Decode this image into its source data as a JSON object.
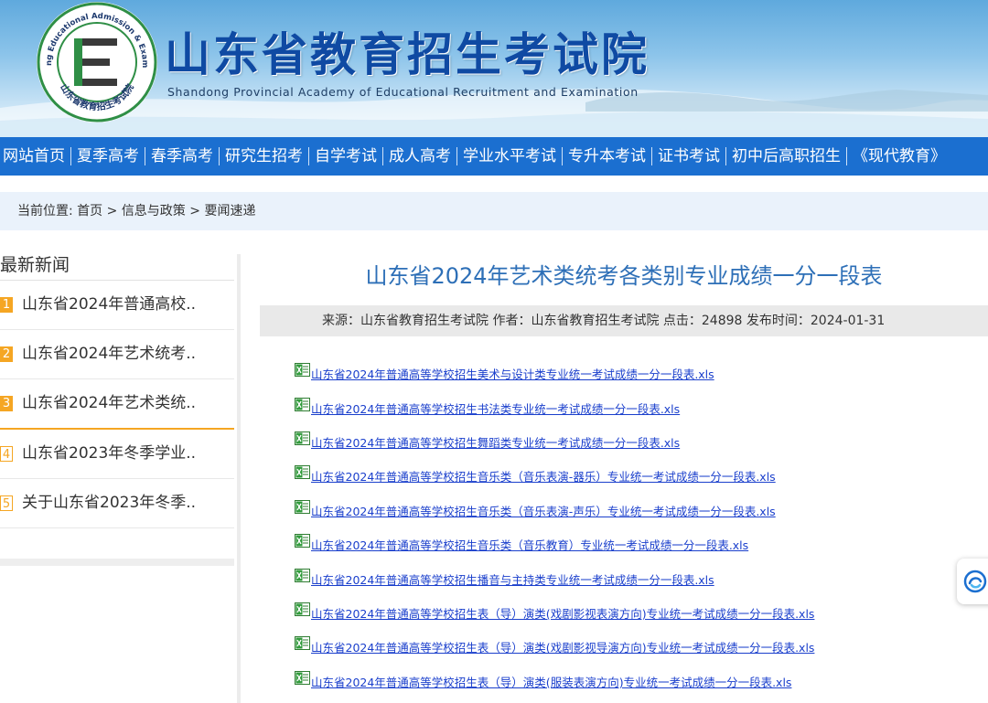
{
  "header": {
    "title": "山东省教育招生考试院",
    "subtitle": "Shandong Provincial Academy of Educational Recruitment and Examination",
    "logo": {
      "ring_text_top": "Shandong Educational Admission & Examination",
      "ring_text_bottom": "山东省教育招生考试院",
      "center_letter": "E"
    }
  },
  "nav": {
    "items": [
      "网站首页",
      "夏季高考",
      "春季高考",
      "研究生招考",
      "自学考试",
      "成人高考",
      "学业水平考试",
      "专升本考试",
      "证书考试",
      "初中后高职招生",
      "《现代教育》"
    ]
  },
  "breadcrumb": {
    "prefix": "当前位置:",
    "items": [
      "首页",
      "信息与政策",
      "要闻速递"
    ],
    "separator": ">"
  },
  "sidebar": {
    "title": "最新新闻",
    "items": [
      {
        "num": "1",
        "text": "山东省2024年普通高校.."
      },
      {
        "num": "2",
        "text": "山东省2024年艺术统考.."
      },
      {
        "num": "3",
        "text": "山东省2024年艺术类统.."
      },
      {
        "num": "4",
        "text": "山东省2023年冬季学业.."
      },
      {
        "num": "5",
        "text": "关于山东省2023年冬季.."
      }
    ]
  },
  "article": {
    "title": "山东省2024年艺术类统考各类别专业成绩一分一段表",
    "meta": "来源：山东省教育招生考试院 作者：山东省教育招生考试院 点击：24898 发布时间：2024-01-31",
    "files": [
      "山东省2024年普通高等学校招生美术与设计类专业统一考试成绩一分一段表.xls",
      "山东省2024年普通高等学校招生书法类专业统一考试成绩一分一段表.xls",
      "山东省2024年普通高等学校招生舞蹈类专业统一考试成绩一分一段表.xls",
      "山东省2024年普通高等学校招生音乐类（音乐表演-器乐）专业统一考试成绩一分一段表.xls",
      "山东省2024年普通高等学校招生音乐类（音乐表演-声乐）专业统一考试成绩一分一段表.xls",
      "山东省2024年普通高等学校招生音乐类（音乐教育）专业统一考试成绩一分一段表.xls",
      "山东省2024年普通高等学校招生播音与主持类专业统一考试成绩一分一段表.xls",
      "山东省2024年普通高等学校招生表（导）演类(戏剧影视表演方向)专业统一考试成绩一分一段表.xls",
      "山东省2024年普通高等学校招生表（导）演类(戏剧影视导演方向)专业统一考试成绩一分一段表.xls",
      "山东省2024年普通高等学校招生表（导）演类(服装表演方向)专业统一考试成绩一分一段表.xls"
    ]
  },
  "float_widget": {
    "icon": "assistant-icon"
  },
  "colors": {
    "nav_bg": "#1b6fd0",
    "title_blue": "#0f4aa3",
    "article_title": "#2d6fb7",
    "link": "#1a3fcc",
    "accent_orange": "#f5a623",
    "breadcrumb_bg": "#eaf2fb",
    "meta_bg": "#e9e9e9"
  }
}
